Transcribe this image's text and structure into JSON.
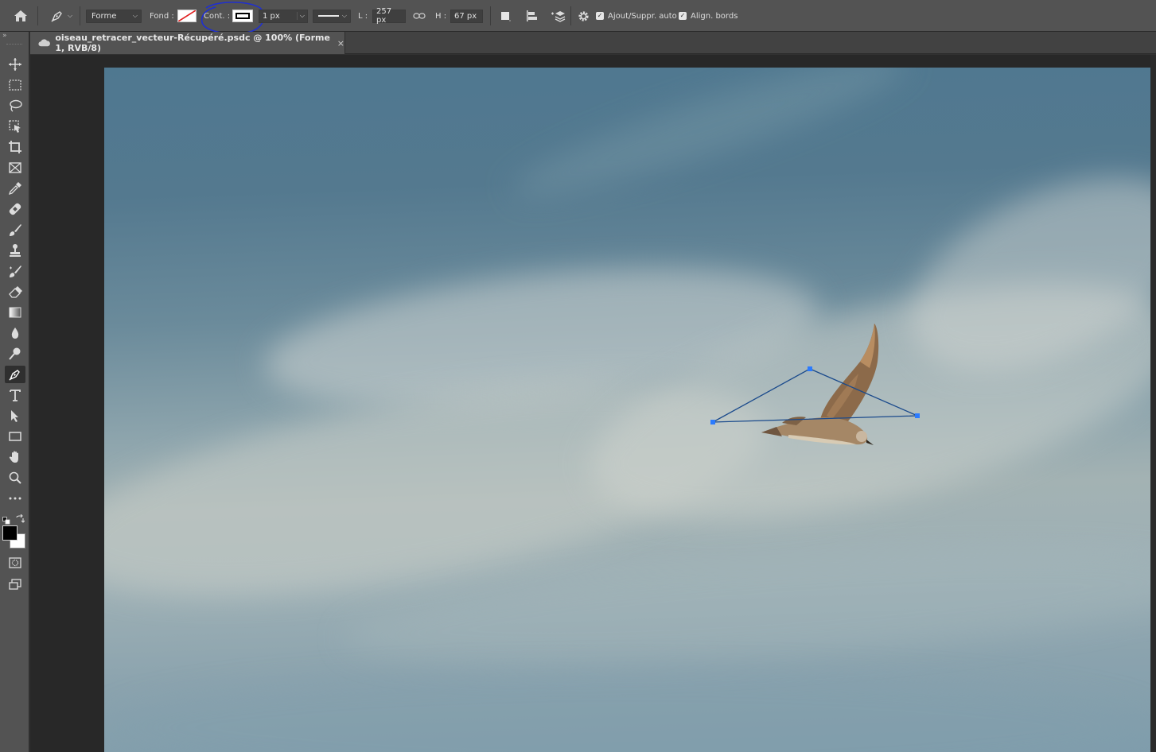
{
  "options_bar": {
    "mode_label": "Forme",
    "fill_label": "Fond :",
    "stroke_label": "Cont. :",
    "stroke_width": "1 px",
    "width_label": "L :",
    "width_value": "257 px",
    "height_label": "H :",
    "height_value": "67 px",
    "auto_add_delete_label": "Ajout/Suppr. auto",
    "align_edges_label": "Align. bords"
  },
  "document": {
    "tab_title": "oiseau_retracer_vecteur-Récupéré.psdc @ 100% (Forme 1, RVB/8)",
    "close_glyph": "×"
  },
  "colors": {
    "path_stroke": "#1a4a8c",
    "anchor_point": "#2b7bff",
    "annotation_circle": "#1f2fd0",
    "foreground": "#000000",
    "background": "#ffffff"
  },
  "toolbar": {
    "active_tool": "pen-tool"
  },
  "icons": [
    "home-icon",
    "pen-tool-icon",
    "move-icon",
    "marquee-icon",
    "lasso-icon",
    "object-selection-icon",
    "crop-icon",
    "frame-icon",
    "eyedropper-icon",
    "healing-brush-icon",
    "brush-icon",
    "clone-stamp-icon",
    "history-brush-icon",
    "eraser-icon",
    "gradient-icon",
    "blur-icon",
    "dodge-icon",
    "type-icon",
    "path-selection-icon",
    "rectangle-icon",
    "hand-icon",
    "zoom-icon",
    "more-tools-icon",
    "gear-icon",
    "cloud-icon"
  ]
}
